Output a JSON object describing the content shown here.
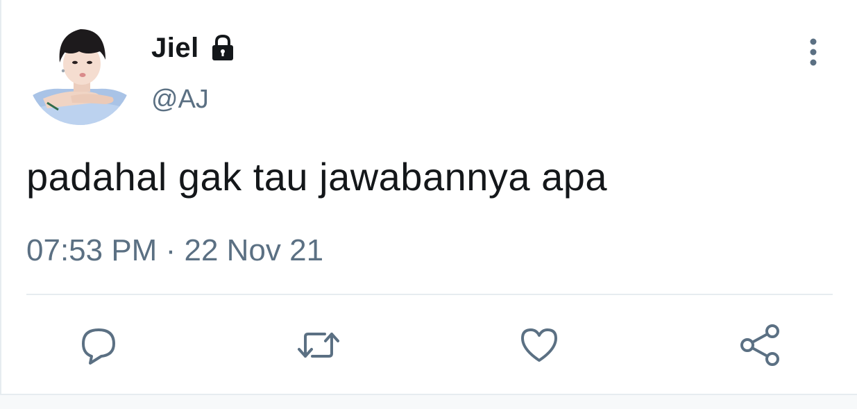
{
  "tweet": {
    "display_name": "Jiel",
    "handle": "@AJ",
    "text": "padahal gak tau jawabannya apa",
    "time": "07:53 PM",
    "separator": "·",
    "date": "22 Nov 21"
  },
  "icons": {
    "protected": "lock-icon",
    "more": "more-vertical-icon",
    "reply": "reply-icon",
    "retweet": "retweet-icon",
    "like": "like-icon",
    "share": "share-icon"
  },
  "colors": {
    "text_primary": "#14171a",
    "text_secondary": "#5b7083",
    "divider": "#e6ecf0"
  }
}
